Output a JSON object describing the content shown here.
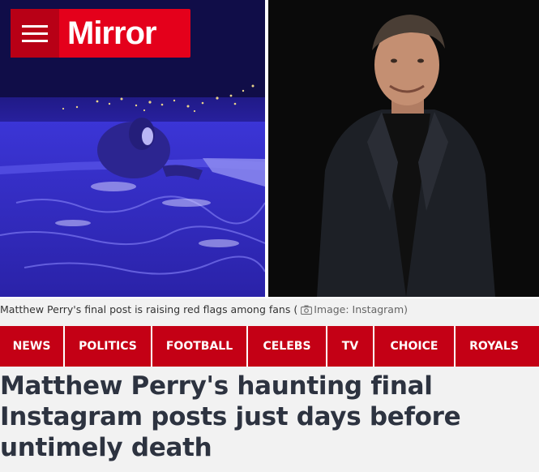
{
  "brand": {
    "logo_text": "Mirror",
    "color": "#e4001b"
  },
  "hero": {
    "caption_text": "Matthew Perry's final post is raising red flags among fans (",
    "caption_icon": "camera-icon",
    "caption_credit": "Image: Instagram)"
  },
  "nav": {
    "color": "#c40015",
    "items": [
      {
        "label": "NEWS"
      },
      {
        "label": "POLITICS"
      },
      {
        "label": "FOOTBALL"
      },
      {
        "label": "CELEBS"
      },
      {
        "label": "TV"
      },
      {
        "label": "CHOICE"
      },
      {
        "label": "ROYALS"
      }
    ]
  },
  "article": {
    "headline": "Matthew Perry's haunting final Instagram posts just days before untimely death"
  }
}
